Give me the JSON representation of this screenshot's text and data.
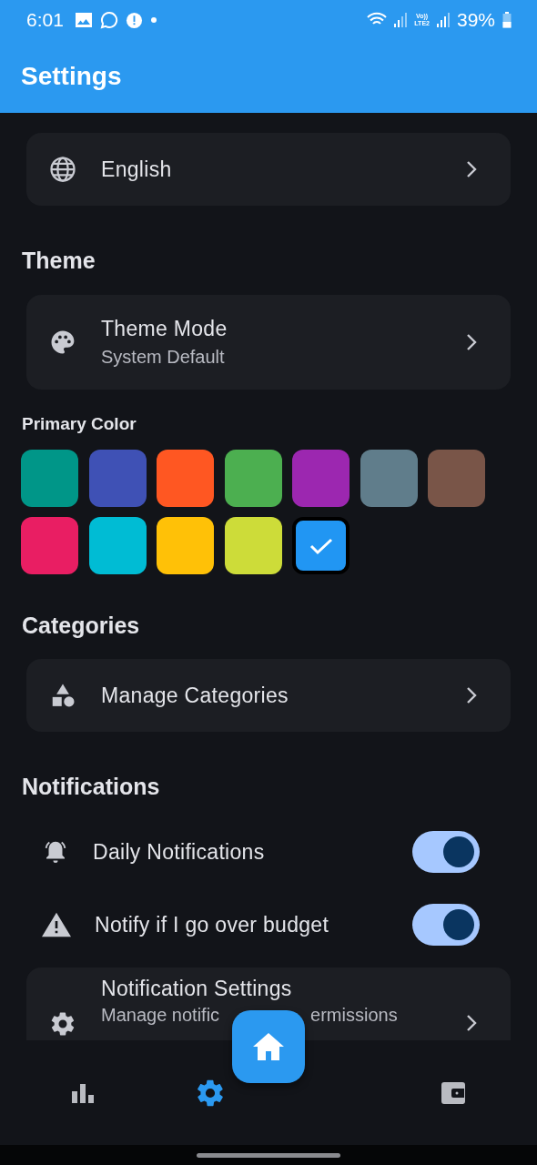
{
  "status_bar": {
    "time": "6:01",
    "volte": "Vo))",
    "network": "LTE2",
    "battery": "39%"
  },
  "app_bar": {
    "title": "Settings"
  },
  "language_card": {
    "title": "English"
  },
  "theme": {
    "heading": "Theme",
    "card": {
      "title": "Theme Mode",
      "subtitle": "System Default"
    },
    "primary_color_label": "Primary Color",
    "colors": [
      {
        "color": "#009688",
        "selected": false
      },
      {
        "color": "#3f51b5",
        "selected": false
      },
      {
        "color": "#ff5722",
        "selected": false
      },
      {
        "color": "#4caf50",
        "selected": false
      },
      {
        "color": "#9c27b0",
        "selected": false
      },
      {
        "color": "#607d8b",
        "selected": false
      },
      {
        "color": "#795548",
        "selected": false
      },
      {
        "color": "#e91e63",
        "selected": false
      },
      {
        "color": "#00bcd4",
        "selected": false
      },
      {
        "color": "#ffc107",
        "selected": false
      },
      {
        "color": "#cddc39",
        "selected": false
      },
      {
        "color": "#2196f3",
        "selected": true
      }
    ]
  },
  "categories": {
    "heading": "Categories",
    "card": {
      "title": "Manage Categories"
    }
  },
  "notifications": {
    "heading": "Notifications",
    "toggles": [
      {
        "label": "Daily Notifications",
        "on": true
      },
      {
        "label": "Notify if I go over budget",
        "on": true
      }
    ],
    "card": {
      "title": "Notification Settings",
      "subtitle_parts": [
        "Manage notific",
        "ermissions"
      ]
    }
  },
  "bottom_nav": {
    "items": [
      {
        "selected": false
      },
      {
        "selected": true
      },
      {
        "selected": false
      }
    ]
  }
}
